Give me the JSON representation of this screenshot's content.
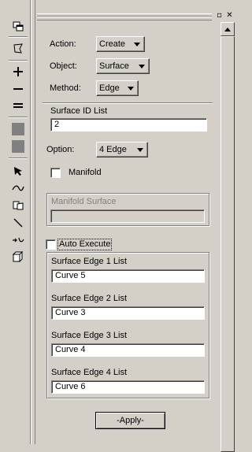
{
  "toolbar": {
    "icons": [
      "windows-icon",
      "lasso-icon",
      "plus-icon",
      "minus-icon",
      "equals-icon",
      "gray-square-icon",
      "gray-square-icon",
      "arrow-pointer-icon",
      "curve-icon",
      "surface-icon",
      "line-icon",
      "move-icon",
      "solid-icon"
    ]
  },
  "titlebar": {
    "buttons": [
      "restore",
      "close"
    ]
  },
  "form": {
    "action_label": "Action:",
    "action_value": "Create",
    "object_label": "Object:",
    "object_value": "Surface",
    "method_label": "Method:",
    "method_value": "Edge",
    "surface_id_label": "Surface ID List",
    "surface_id_value": "2",
    "option_label": "Option:",
    "option_value": "4 Edge",
    "manifold_label": "Manifold",
    "manifold_checked": false,
    "manifold_surface_label": "Manifold Surface",
    "manifold_surface_value": "",
    "auto_execute_label": "Auto Execute",
    "auto_execute_checked": false,
    "edges": [
      {
        "label": "Surface Edge 1 List",
        "value": "Curve 5"
      },
      {
        "label": "Surface Edge 2 List",
        "value": "Curve 3"
      },
      {
        "label": "Surface Edge 3 List",
        "value": "Curve 4"
      },
      {
        "label": "Surface Edge 4 List",
        "value": "Curve 6"
      }
    ],
    "apply_label": "-Apply-"
  }
}
